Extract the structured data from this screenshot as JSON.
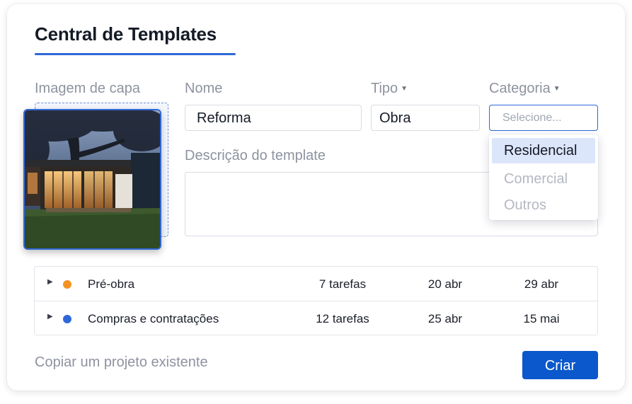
{
  "panel": {
    "title": "Central de Templates",
    "accent_color": "#2f67d8"
  },
  "form": {
    "cover_label": "Imagem de capa",
    "cover_image": "modern-house-photo",
    "name_label": "Nome",
    "name_value": "Reforma",
    "type_label": "Tipo",
    "type_value": "Obra",
    "category_label": "Categoria",
    "category_placeholder": "Selecione...",
    "description_label": "Descrição do template",
    "description_value": ""
  },
  "category_dropdown": {
    "options": [
      {
        "label": "Residencial",
        "state": "highlighted"
      },
      {
        "label": "Comercial",
        "state": "muted"
      },
      {
        "label": "Outros",
        "state": "muted"
      }
    ]
  },
  "phases": [
    {
      "name": "Pré-obra",
      "dot_color": "#f39325",
      "tasks": "7 tarefas",
      "start": "20 abr",
      "end": "29 abr"
    },
    {
      "name": "Compras e contratações",
      "dot_color": "#2f67d8",
      "tasks": "12 tarefas",
      "start": "25 abr",
      "end": "15 mai"
    }
  ],
  "footer": {
    "copy_link": "Copiar um projeto existente",
    "create_button": "Criar",
    "create_button_color": "#0a58cc"
  }
}
